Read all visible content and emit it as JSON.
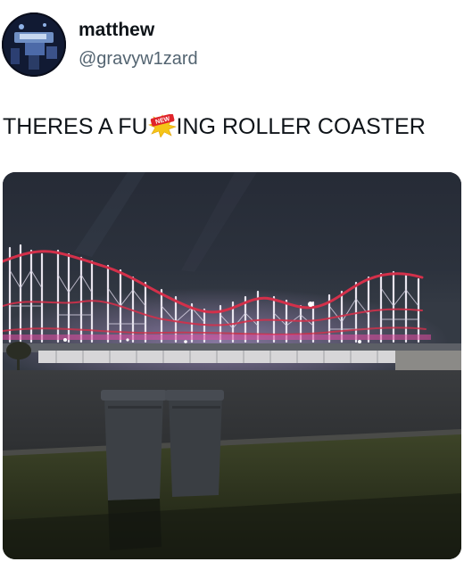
{
  "author": {
    "display_name": "matthew",
    "handle": "@gravyw1zard",
    "avatar_icon": "avatar-image"
  },
  "tweet": {
    "text_before": "THERES A FU",
    "text_after": "ING ROLLER COASTER",
    "censor_sticker_text": "NEW",
    "censor_icon": "censor-sticker-icon"
  },
  "media": {
    "description_icon": "roller-coaster-photo"
  },
  "colors": {
    "text": "#0f1419",
    "secondary_text": "#536471",
    "sticker_yellow": "#f5c518",
    "sticker_red": "#e0252b"
  }
}
